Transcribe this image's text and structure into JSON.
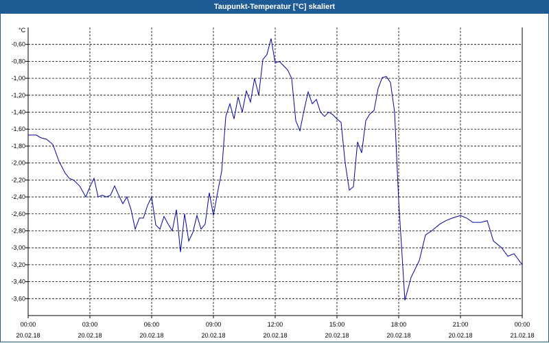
{
  "window": {
    "title": "Taupunkt-Temperatur [°C] skaliert"
  },
  "chart_data": {
    "type": "line",
    "title": "Taupunkt-Temperatur [°C] skaliert",
    "ylabel": "°C",
    "ylim": [
      -3.8,
      -0.4
    ],
    "grid": true,
    "y_ticks": [
      "-0,60",
      "-0,80",
      "-1,00",
      "-1,20",
      "-1,40",
      "-1,60",
      "-1,80",
      "-2,00",
      "-2,20",
      "-2,40",
      "-2,60",
      "-2,80",
      "-3,00",
      "-3,20",
      "-3,40",
      "-3,60"
    ],
    "y_tick_values": [
      -0.6,
      -0.8,
      -1.0,
      -1.2,
      -1.4,
      -1.6,
      -1.8,
      -2.0,
      -2.2,
      -2.4,
      -2.6,
      -2.8,
      -3.0,
      -3.2,
      -3.4,
      -3.6
    ],
    "x_ticks": [
      {
        "time": "00:00",
        "date": "20.02.18",
        "hour": 0
      },
      {
        "time": "03:00",
        "date": "20.02.18",
        "hour": 3
      },
      {
        "time": "06:00",
        "date": "20.02.18",
        "hour": 6
      },
      {
        "time": "09:00",
        "date": "20.02.18",
        "hour": 9
      },
      {
        "time": "12:00",
        "date": "20.02.18",
        "hour": 12
      },
      {
        "time": "15:00",
        "date": "20.02.18",
        "hour": 15
      },
      {
        "time": "18:00",
        "date": "20.02.18",
        "hour": 18
      },
      {
        "time": "21:00",
        "date": "20.02.18",
        "hour": 21
      },
      {
        "time": "00:00",
        "date": "21.02.18",
        "hour": 24
      }
    ],
    "series": [
      {
        "color": "#0000a0",
        "x": [
          0,
          0.4,
          0.6,
          0.9,
          1.2,
          1.5,
          1.8,
          2.0,
          2.2,
          2.5,
          2.8,
          3.0,
          3.2,
          3.4,
          3.6,
          3.8,
          4.0,
          4.2,
          4.4,
          4.6,
          4.8,
          5.0,
          5.2,
          5.4,
          5.6,
          5.8,
          6.0,
          6.2,
          6.4,
          6.6,
          6.8,
          7.0,
          7.2,
          7.4,
          7.6,
          7.8,
          8.0,
          8.2,
          8.4,
          8.6,
          8.8,
          9.0,
          9.2,
          9.4,
          9.6,
          9.8,
          10.0,
          10.2,
          10.4,
          10.6,
          10.8,
          11.0,
          11.2,
          11.4,
          11.6,
          11.8,
          12.0,
          12.2,
          12.4,
          12.6,
          12.8,
          13.0,
          13.2,
          13.4,
          13.6,
          13.8,
          14.0,
          14.2,
          14.4,
          14.6,
          14.8,
          15.0,
          15.2,
          15.4,
          15.6,
          15.8,
          16.0,
          16.2,
          16.4,
          16.6,
          16.8,
          17.0,
          17.2,
          17.4,
          17.6,
          17.8,
          18.0,
          18.3,
          18.6,
          19.0,
          19.3,
          19.6,
          20.0,
          20.3,
          20.6,
          21.0,
          21.3,
          21.6,
          22.0,
          22.3,
          22.6,
          23.0,
          23.3,
          23.6,
          24.0
        ],
        "values": [
          -1.67,
          -1.67,
          -1.7,
          -1.72,
          -1.78,
          -1.98,
          -2.12,
          -2.18,
          -2.2,
          -2.27,
          -2.4,
          -2.28,
          -2.18,
          -2.4,
          -2.38,
          -2.4,
          -2.38,
          -2.27,
          -2.38,
          -2.48,
          -2.4,
          -2.55,
          -2.78,
          -2.65,
          -2.65,
          -2.5,
          -2.4,
          -2.73,
          -2.78,
          -2.63,
          -2.72,
          -2.8,
          -2.55,
          -3.05,
          -2.6,
          -2.92,
          -2.82,
          -2.62,
          -2.78,
          -2.72,
          -2.35,
          -2.62,
          -2.35,
          -2.1,
          -1.45,
          -1.3,
          -1.48,
          -1.22,
          -1.4,
          -1.15,
          -1.28,
          -1.0,
          -1.2,
          -0.78,
          -0.72,
          -0.53,
          -0.82,
          -0.8,
          -0.85,
          -0.9,
          -1.0,
          -1.5,
          -1.62,
          -1.38,
          -1.16,
          -1.3,
          -1.25,
          -1.4,
          -1.45,
          -1.4,
          -1.43,
          -1.48,
          -1.52,
          -2.0,
          -2.32,
          -2.28,
          -1.75,
          -1.88,
          -1.5,
          -1.42,
          -1.38,
          -1.12,
          -0.99,
          -0.98,
          -1.05,
          -1.4,
          -2.45,
          -3.62,
          -3.35,
          -3.15,
          -2.85,
          -2.8,
          -2.72,
          -2.68,
          -2.65,
          -2.62,
          -2.65,
          -2.7,
          -2.7,
          -2.68,
          -2.92,
          -3.0,
          -3.1,
          -3.07,
          -3.2
        ]
      }
    ]
  }
}
